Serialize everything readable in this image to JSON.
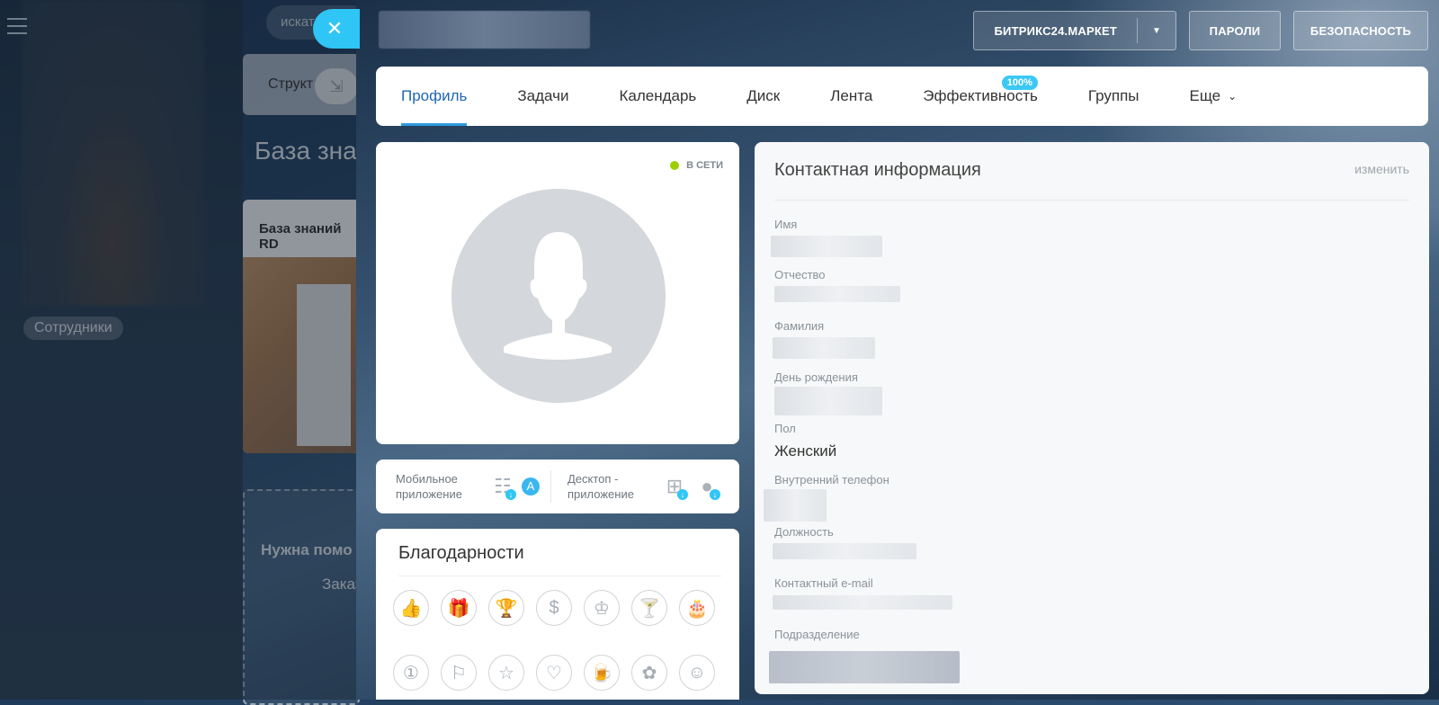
{
  "background": {
    "search_placeholder": "искат",
    "structure_label": "Структ",
    "knowledge_base_title": "База знан",
    "kb_card_title": "База знаний RD",
    "help_title": "Нужна помо",
    "help_action": "Заказ",
    "employees_label": "Сотрудники"
  },
  "header": {
    "market_label": "БИТРИКС24.МАРКЕТ",
    "passwords_label": "ПАРОЛИ",
    "security_label": "БЕЗОПАСНОСТЬ"
  },
  "tabs": [
    {
      "label": "Профиль",
      "active": true
    },
    {
      "label": "Задачи"
    },
    {
      "label": "Календарь"
    },
    {
      "label": "Диск"
    },
    {
      "label": "Лента"
    },
    {
      "label": "Эффективность",
      "badge": "100%"
    },
    {
      "label": "Группы"
    },
    {
      "label": "Еще"
    }
  ],
  "profile": {
    "status": "В СЕТИ",
    "status_color": "#9dcf00"
  },
  "apps": {
    "mobile_label": "Мобильное приложение",
    "desktop_label": "Десктоп - приложение",
    "mobile_icons": [
      "android-icon",
      "app-store-icon"
    ],
    "desktop_icons": [
      "windows-icon",
      "apple-icon"
    ]
  },
  "gratitudes": {
    "title": "Благодарности",
    "icons": [
      "thumbs-up-icon",
      "gift-icon",
      "trophy-icon",
      "money-bag-icon",
      "crown-icon",
      "cocktail-icon",
      "cake-icon",
      "number-one-icon",
      "flag-icon",
      "star-icon",
      "heart-icon",
      "beer-icon",
      "flower-icon",
      "smile-icon"
    ]
  },
  "contact": {
    "title": "Контактная информация",
    "edit_label": "изменить",
    "fields": [
      {
        "label": "Имя"
      },
      {
        "label": "Отчество"
      },
      {
        "label": "Фамилия"
      },
      {
        "label": "День рождения"
      },
      {
        "label": "Пол",
        "value": "Женский"
      },
      {
        "label": "Внутренний телефон"
      },
      {
        "label": "Должность"
      },
      {
        "label": "Контактный e-mail"
      },
      {
        "label": "Подразделение"
      }
    ]
  },
  "colors": {
    "accent": "#2fc6f6",
    "active_tab": "#2067b0",
    "badge": "#3bc8f5"
  }
}
